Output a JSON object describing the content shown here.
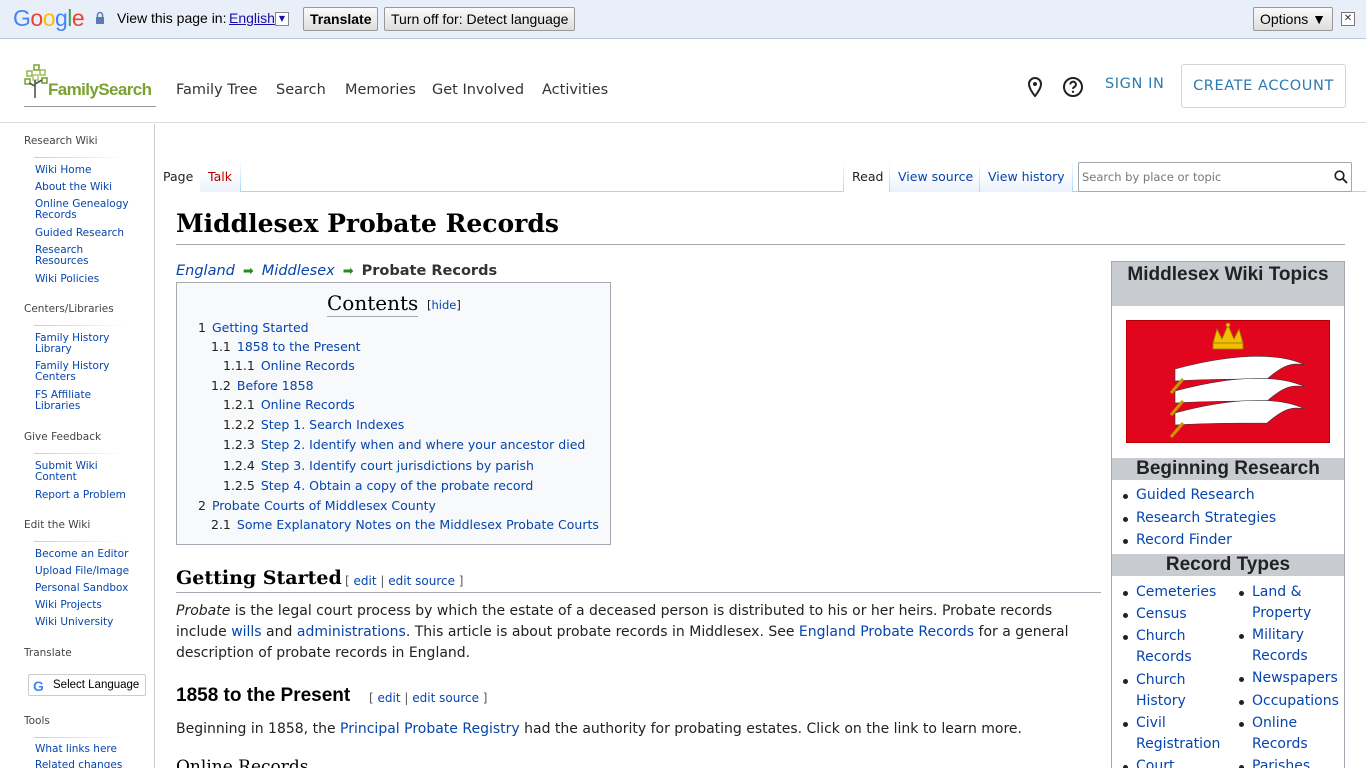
{
  "translate_bar": {
    "logo": "Google",
    "view_text": "View this page in:",
    "language": "English",
    "translate_btn": "Translate",
    "turnoff_btn": "Turn off for: Detect language",
    "options_btn": "Options ▼",
    "close": "✕"
  },
  "header": {
    "logo_text": "FamilySearch",
    "nav": [
      "Family Tree",
      "Search",
      "Memories",
      "Get Involved",
      "Activities"
    ],
    "sign_in": "SIGN IN",
    "create_account": "CREATE ACCOUNT"
  },
  "sidebar": {
    "sections": [
      {
        "heading": "Research Wiki",
        "items": [
          "Wiki Home",
          "About the Wiki",
          "Online Genealogy Records",
          "Guided Research",
          "Research Resources",
          "Wiki Policies"
        ]
      },
      {
        "heading": "Centers/Libraries",
        "items": [
          "Family History Library",
          "Family History Centers",
          "FS Affiliate Libraries"
        ]
      },
      {
        "heading": "Give Feedback",
        "items": [
          "Submit Wiki Content",
          "Report a Problem"
        ]
      },
      {
        "heading": "Edit the Wiki",
        "items": [
          "Become an Editor",
          "Upload File/Image",
          "Personal Sandbox",
          "Wiki Projects",
          "Wiki University"
        ]
      },
      {
        "heading": "Translate",
        "items": []
      },
      {
        "heading": "Tools",
        "items": [
          "What links here",
          "Related changes"
        ]
      }
    ],
    "translate_button": "Select Language"
  },
  "tabs": {
    "left": [
      "Page",
      "Talk"
    ],
    "right": [
      "Read",
      "View source",
      "View history"
    ]
  },
  "search": {
    "placeholder": "Search by place or topic"
  },
  "page": {
    "title": "Middlesex Probate Records",
    "breadcrumb": [
      "England",
      "Middlesex",
      "Probate Records"
    ],
    "toc": {
      "title": "Contents",
      "hide_open": "[",
      "hide": "hide",
      "hide_close": "]",
      "items": [
        {
          "num": "1",
          "text": "Getting Started"
        },
        {
          "num": "1.1",
          "text": "1858 to the Present"
        },
        {
          "num": "1.1.1",
          "text": "Online Records"
        },
        {
          "num": "1.2",
          "text": "Before 1858"
        },
        {
          "num": "1.2.1",
          "text": "Online Records"
        },
        {
          "num": "1.2.2",
          "text": "Step 1. Search Indexes"
        },
        {
          "num": "1.2.3",
          "text": "Step 2. Identify when and where your ancestor died"
        },
        {
          "num": "1.2.4",
          "text": "Step 3. Identify court jurisdictions by parish"
        },
        {
          "num": "1.2.5",
          "text": "Step 4. Obtain a copy of the probate record"
        },
        {
          "num": "2",
          "text": "Probate Courts of Middlesex County"
        },
        {
          "num": "2.1",
          "text": "Some Explanatory Notes on the Middlesex Probate Courts"
        }
      ]
    },
    "edit_open": "[",
    "edit": "edit",
    "edit_sep": "|",
    "edit_source": "edit source",
    "edit_close": "]",
    "section1": {
      "heading": "Getting Started",
      "p1": "Probate",
      "p2": " is the legal court process by which the estate of a deceased person is distributed to his or her heirs. Probate records include ",
      "p3": "wills",
      "p4": " and ",
      "p5": "administrations",
      "p6": ". This article is about probate records in Middlesex. See ",
      "p7": "England Probate Records",
      "p8": " for a general description of probate records in England."
    },
    "section2": {
      "heading": "1858 to the Present",
      "p1": "Beginning in 1858, the ",
      "p2": "Principal Probate Registry",
      "p3": " had the authority for probating estates. Click on the link to learn more."
    },
    "section3": {
      "heading": "Online Records"
    }
  },
  "infobox": {
    "title": "Middlesex Wiki Topics",
    "beginning_heading": "Beginning Research",
    "beginning_items": [
      "Guided Research",
      "Research Strategies",
      "Record Finder"
    ],
    "record_types_heading": "Record Types",
    "col1": [
      "Cemeteries",
      "Census",
      "Church Records",
      "Church History",
      "Civil Registration",
      "Court"
    ],
    "col2": [
      "Land & Property",
      "Military Records",
      "Newspapers",
      "Occupations",
      "Online Records",
      "Parishes"
    ]
  },
  "colors": {
    "link": "#0645ad",
    "brand_green": "#7aa22e",
    "flag_red": "#e1061e",
    "action_blue": "#2b7bb0"
  }
}
